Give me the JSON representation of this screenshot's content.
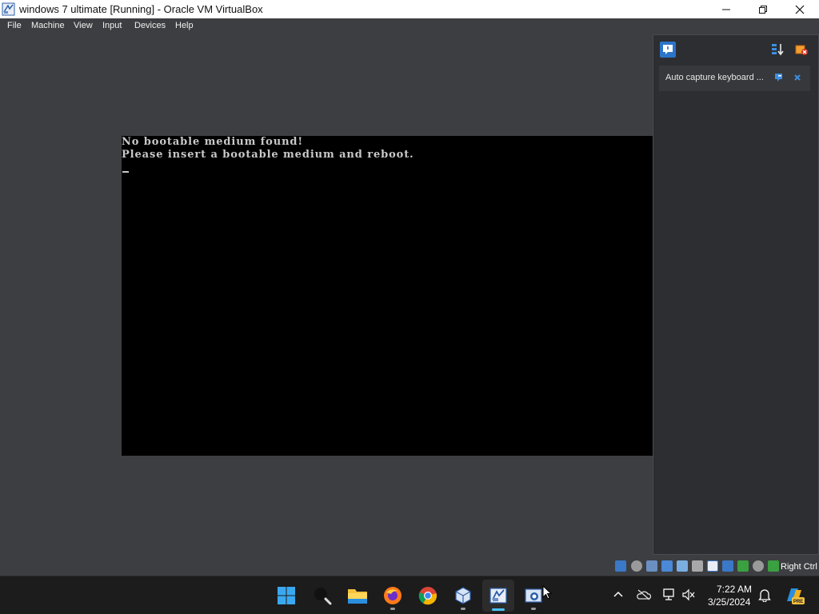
{
  "window": {
    "title": "windows 7 ultimate [Running] - Oracle VM VirtualBox",
    "controls": [
      "minimize-icon",
      "maximize-icon",
      "close-icon"
    ]
  },
  "menu": {
    "items": [
      {
        "label": "File"
      },
      {
        "label": "Machine"
      },
      {
        "label": "View"
      },
      {
        "label": "Input"
      },
      {
        "label": "Devices"
      },
      {
        "label": "Help"
      }
    ]
  },
  "guest": {
    "lines": [
      "No bootable medium found!",
      "Please insert a bootable medium and reboot."
    ],
    "cursor": "_"
  },
  "notification_center": {
    "notice_text": "Auto capture keyboard ...",
    "icons": [
      "notification-center-icon",
      "sort-icon",
      "suppress-messages-icon",
      "help-icon",
      "close-icon"
    ]
  },
  "statusbar": {
    "host_key": "Right Ctrl",
    "indicators": [
      "hard-disk-icon",
      "optical-drive-icon",
      "audio-icon",
      "network-icon",
      "usb-icon",
      "shared-folders-icon",
      "display-icon",
      "recording-icon",
      "vt-x-icon",
      "mouse-integration-icon",
      "keyboard-icon"
    ]
  },
  "taskbar": {
    "apps": [
      {
        "name": "start-icon"
      },
      {
        "name": "search-icon"
      },
      {
        "name": "file-explorer-icon"
      },
      {
        "name": "firefox-icon"
      },
      {
        "name": "chrome-icon"
      },
      {
        "name": "virtualbox-manager-icon"
      },
      {
        "name": "virtualbox-vm-icon"
      },
      {
        "name": "virtualbox-vm2-icon"
      }
    ],
    "tray_icons": [
      "chevron-up-icon",
      "onedrive-icon",
      "network-icon",
      "volume-icon"
    ],
    "clock": {
      "time": "7:22 AM",
      "date": "3/25/2024"
    },
    "notification_icon": "bell-icon",
    "copilot_icon": "copilot-icon",
    "copilot_badge": "PRE"
  },
  "colors": {
    "window_bg": "#3d3e41",
    "guest_bg": "#000000",
    "guest_text": "#c8c8c8",
    "taskbar_bg": "#1c1c1c",
    "accent": "#4cc2ff"
  }
}
